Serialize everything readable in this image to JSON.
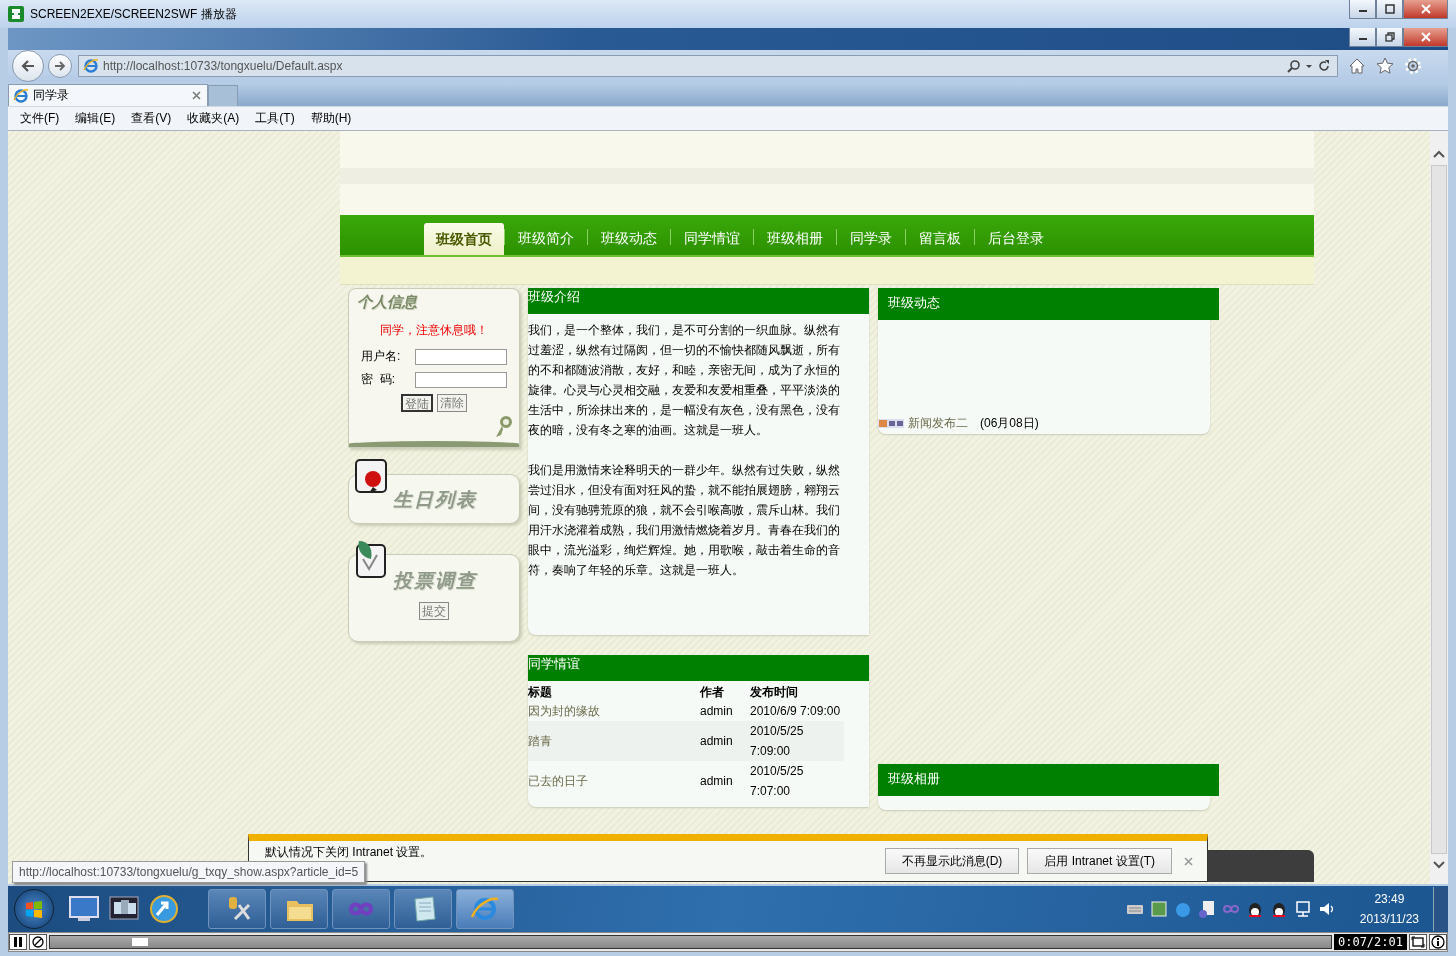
{
  "player_window": {
    "title": "SCREEN2EXE/SCREEN2SWF 播放器"
  },
  "browser": {
    "address": "http://localhost:10733/tongxuelu/Default.aspx",
    "tabs": [
      {
        "label": "同学录",
        "selected": true
      }
    ],
    "menu": [
      "文件(F)",
      "编辑(E)",
      "查看(V)",
      "收藏夹(A)",
      "工具(T)",
      "帮助(H)"
    ]
  },
  "page": {
    "nav": [
      {
        "label": "班级首页",
        "selected": true
      },
      {
        "label": "班级简介",
        "selected": false
      },
      {
        "label": "班级动态",
        "selected": false
      },
      {
        "label": "同学情谊",
        "selected": false
      },
      {
        "label": "班级相册",
        "selected": false
      },
      {
        "label": "同学录",
        "selected": false
      },
      {
        "label": "留言板",
        "selected": false
      },
      {
        "label": "后台登录",
        "selected": false
      }
    ],
    "login": {
      "heading": "个人信息",
      "notice": "同学，注意休息哦！",
      "fields": [
        {
          "label": "用户名:"
        },
        {
          "label": "密  码:"
        }
      ],
      "buttons": [
        "登陆",
        "清除"
      ]
    },
    "birthday": {
      "heading": "生日列表"
    },
    "vote": {
      "heading": "投票调查",
      "button": "提交"
    },
    "intro": {
      "title": "班级介绍",
      "paragraphs": [
        "我们，是一个整体，我们，是不可分割的一织血脉。纵然有过羞涩，纵然有过隔阂，但一切的不愉快都随风飘逝，所有的不和都随波消散，友好，和睦，亲密无间，成为了永恒的旋律。心灵与心灵相交融，友爱和友爱相重叠，平平淡淡的生活中，所涂抹出来的，是一幅没有灰色，没有黑色，没有夜的暗，没有冬之寒的油画。这就是一班人。",
        "我们是用激情来诠释明天的一群少年。纵然有过失败，纵然尝过泪水，但没有面对狂风的蛰，就不能拍展翅膀，翱翔云间，没有驰骋荒原的狼，就不会引喉高嗷，震斥山林。我们用汗水浇灌着成熟，我们用激情燃烧着岁月。青春在我们的眼中，流光溢彩，绚烂辉煌。她，用歌喉，敲击着生命的音符，奏响了年轻的乐章。这就是一班人。"
      ]
    },
    "news": {
      "title": "班级动态",
      "items": [
        {
          "title": "新闻发布二",
          "date": "(06月08日)"
        }
      ]
    },
    "friendship": {
      "title": "同学情谊",
      "columns": [
        "标题",
        "作者",
        "发布时间"
      ],
      "rows": [
        {
          "title": "因为封的缘故",
          "author": "admin",
          "time": "2010/6/9 7:09:00"
        },
        {
          "title": "踏青",
          "author": "admin",
          "time": "2010/5/25 7:09:00"
        },
        {
          "title": "已去的日子",
          "author": "admin",
          "time": "2010/5/25 7:07:00"
        }
      ]
    },
    "album": {
      "title": "班级相册"
    }
  },
  "notification": {
    "message": "默认情况下关闭 Intranet 设置。",
    "buttons": [
      "不再显示此消息(D)",
      "启用 Intranet 设置(T)"
    ]
  },
  "status_tooltip": "http://localhost:10733/tongxuelu/g_txqy_show.aspx?article_id=5",
  "taskbar": {
    "time": "23:49",
    "date": "2013/11/23"
  },
  "player": {
    "level": 0.065,
    "time": "0:07/2:01"
  }
}
